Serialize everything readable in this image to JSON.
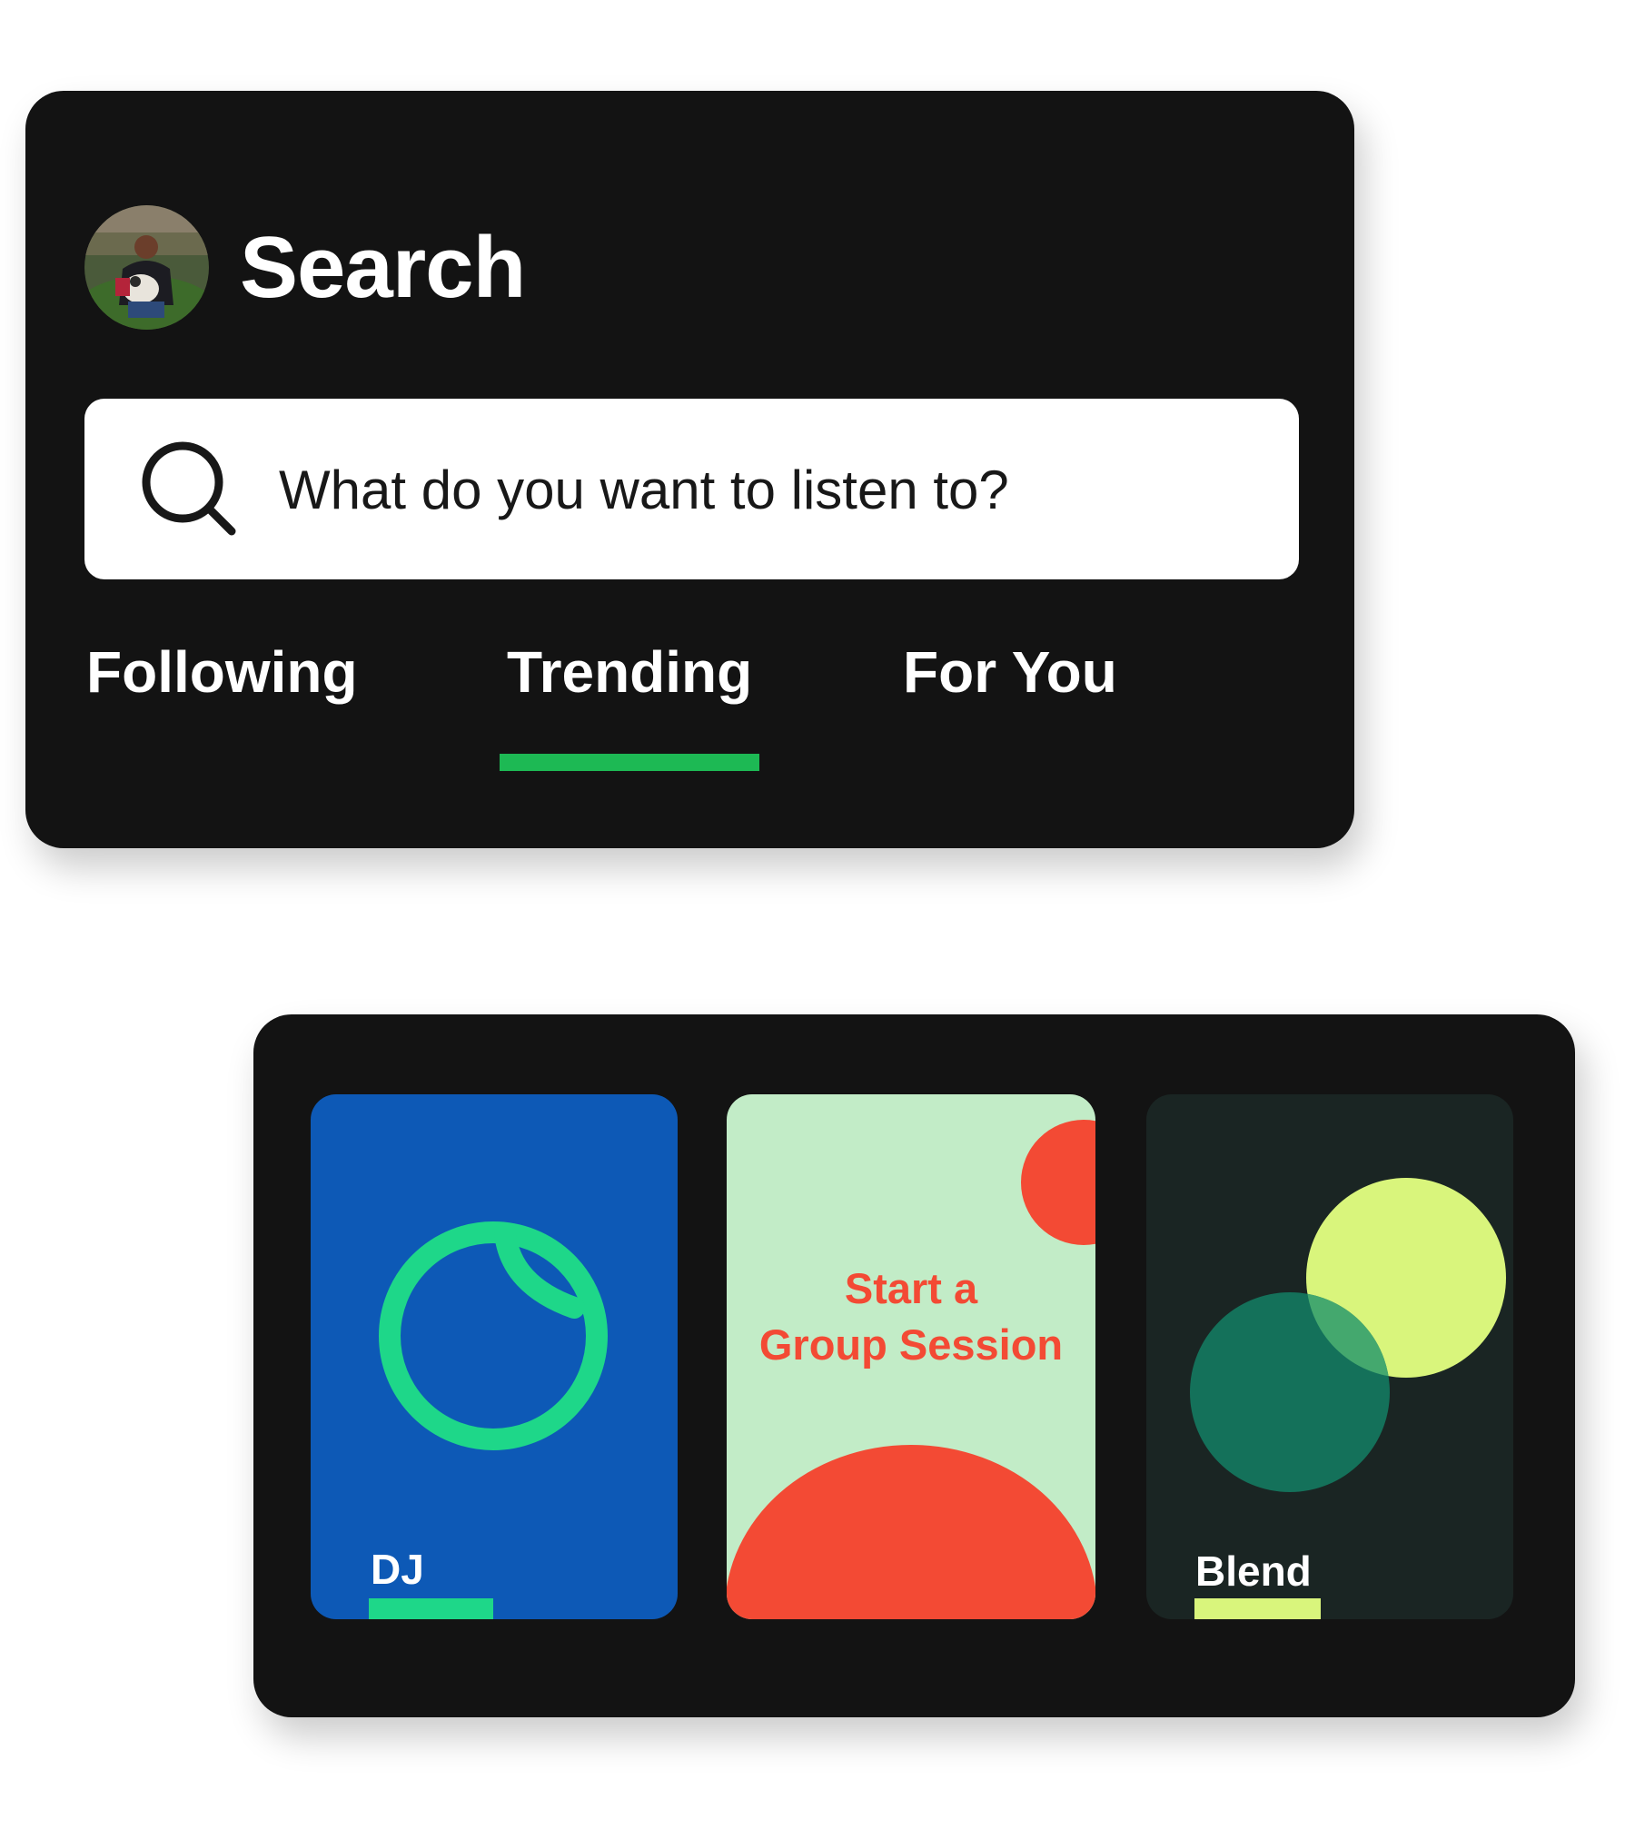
{
  "header": {
    "title": "Search"
  },
  "search": {
    "placeholder": "What do you want to listen to?"
  },
  "tabs": [
    {
      "label": "Following",
      "active": false
    },
    {
      "label": "Trending",
      "active": true
    },
    {
      "label": "For You",
      "active": false
    }
  ],
  "cards": [
    {
      "label": "DJ",
      "color": "#0d59b6",
      "accent": "#1ed789"
    },
    {
      "label": "Start a\nGroup Session",
      "color": "#c2ecc7",
      "accent": "#f34a34"
    },
    {
      "label": "Blend",
      "color": "#1a2523",
      "accent": "#d9f57c"
    }
  ],
  "colors": {
    "panel": "#131313",
    "tab_indicator": "#1db954"
  }
}
